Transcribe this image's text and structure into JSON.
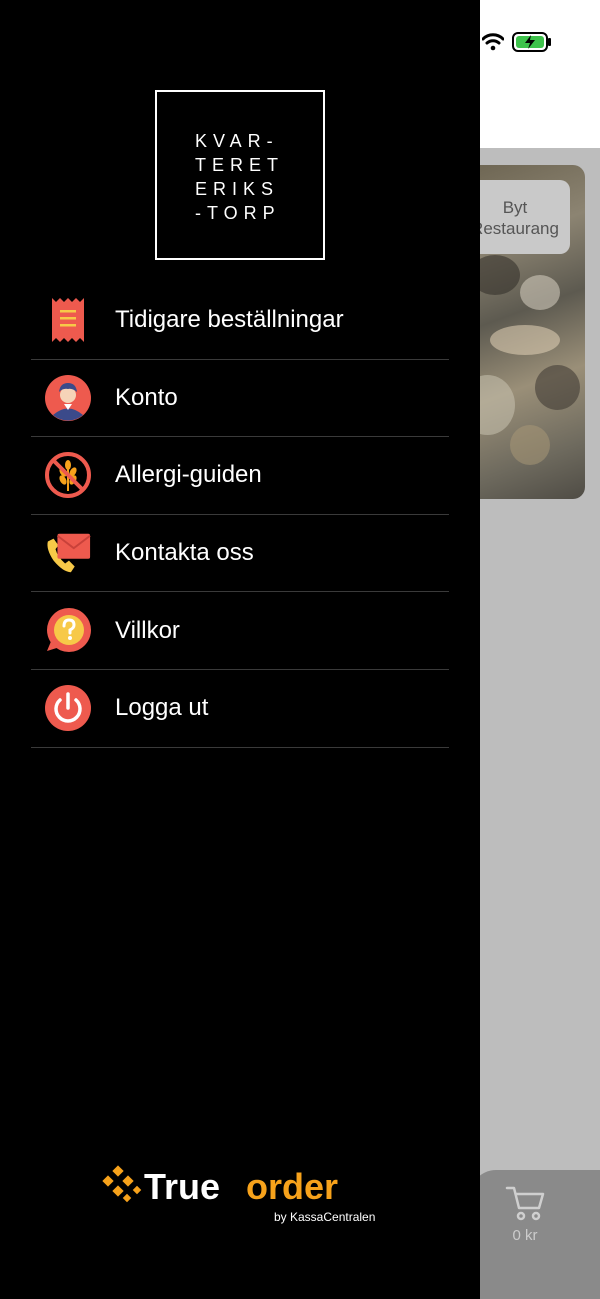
{
  "background_app": {
    "switch_button": {
      "line1": "Byt",
      "line2": "Restaurang"
    },
    "cart_total": "0 kr"
  },
  "drawer": {
    "logo_lines": [
      "KVAR-",
      "TERET",
      "ERIKS",
      "-TORP"
    ],
    "menu": [
      {
        "label": "Tidigare beställningar",
        "icon": "receipt-icon"
      },
      {
        "label": "Konto",
        "icon": "account-avatar-icon"
      },
      {
        "label": "Allergi-guiden",
        "icon": "no-gluten-icon"
      },
      {
        "label": "Kontakta oss",
        "icon": "phone-envelope-icon"
      },
      {
        "label": "Villkor",
        "icon": "question-bubble-icon"
      },
      {
        "label": "Logga ut",
        "icon": "power-icon"
      }
    ],
    "brand": {
      "wordmark_left": "True",
      "wordmark_right": "order",
      "byline": "by KassaCentralen"
    }
  },
  "colors": {
    "accent_orange": "#F7A21B",
    "icon_red": "#EE5A4E",
    "drawer_bg": "#000000"
  }
}
